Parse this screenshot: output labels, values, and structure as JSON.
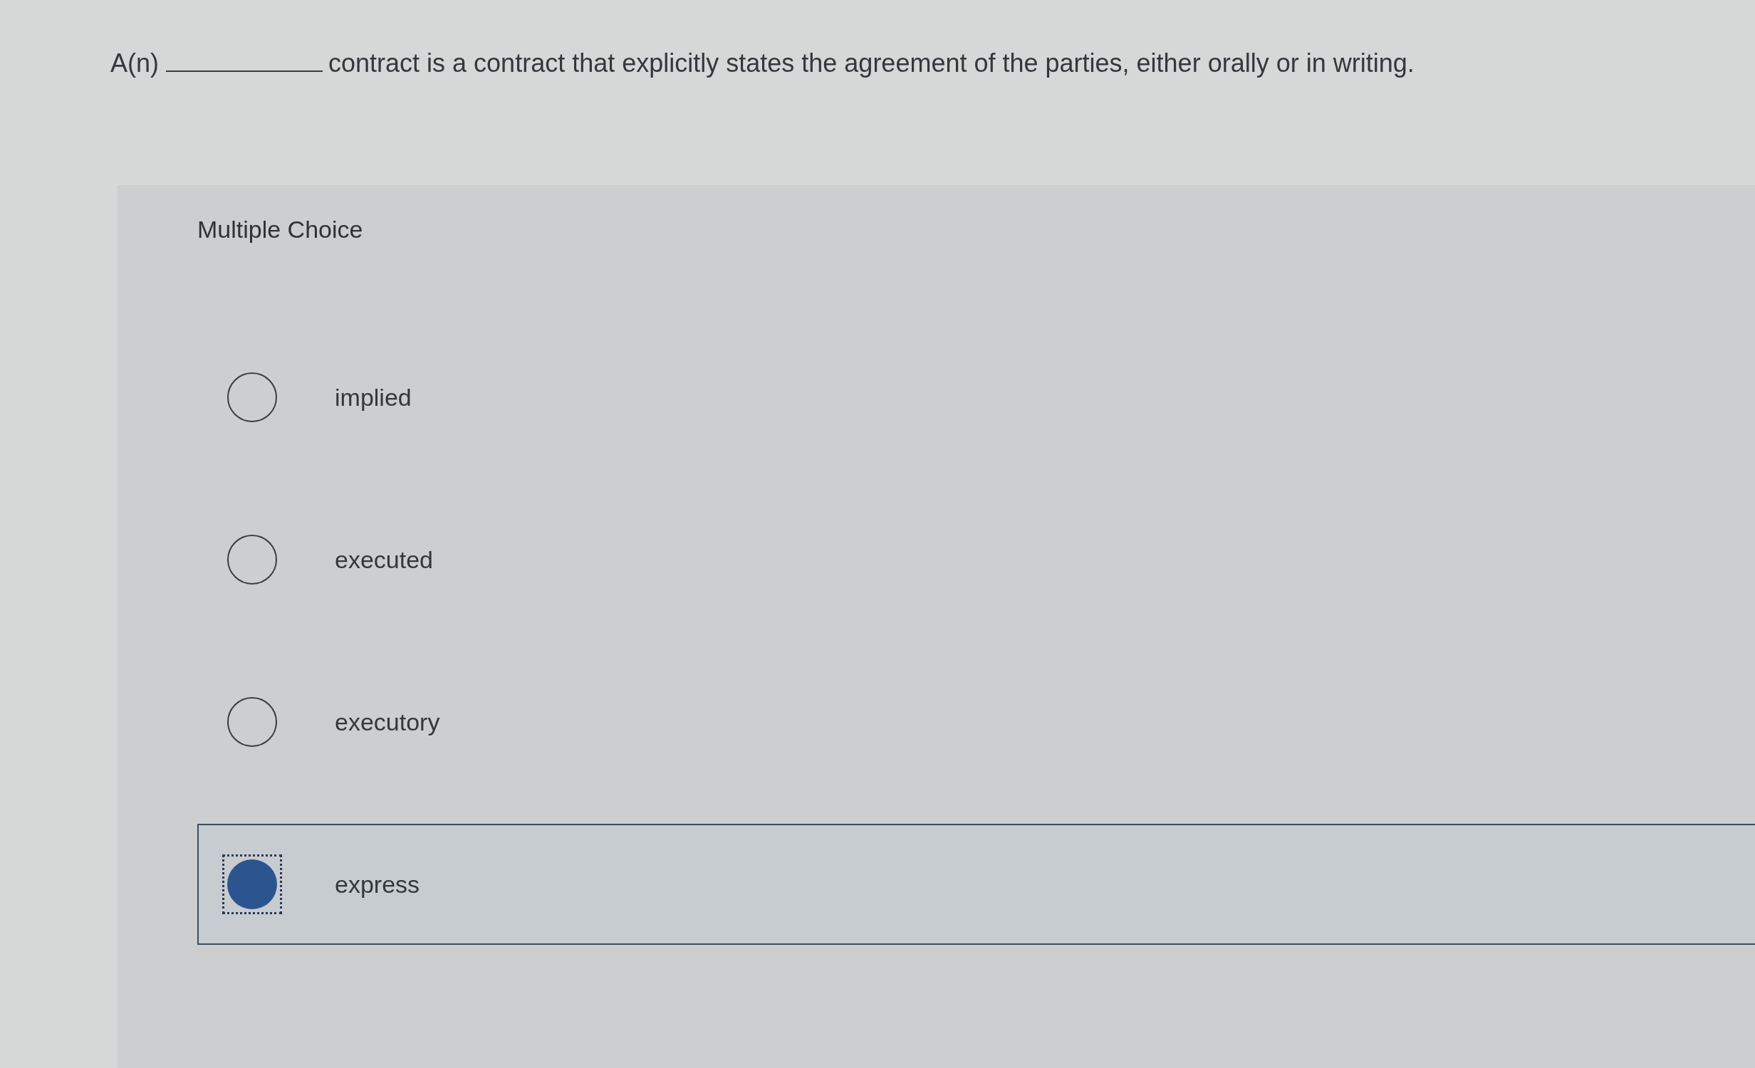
{
  "question": {
    "prefix": "A(n)",
    "text": "contract is a contract that explicitly states the agreement of the parties, either orally or in writing."
  },
  "multiple_choice": {
    "label": "Multiple Choice",
    "options": [
      {
        "label": "implied",
        "selected": false,
        "focused": false
      },
      {
        "label": "executed",
        "selected": false,
        "focused": false
      },
      {
        "label": "executory",
        "selected": false,
        "focused": false
      },
      {
        "label": "express",
        "selected": true,
        "focused": true
      }
    ]
  }
}
